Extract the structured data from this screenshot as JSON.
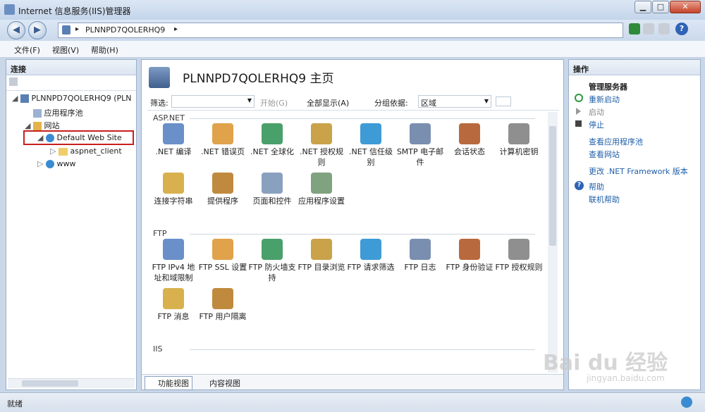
{
  "window": {
    "title": "Internet 信息服务(IIS)管理器",
    "min": "▁",
    "max": "□",
    "close": "✕"
  },
  "nav": {
    "back": "◀",
    "forward": "▶",
    "path": "PLNNPD7QOLERHQ9",
    "sep": "▸"
  },
  "menu": {
    "file": "文件(F)",
    "view": "视图(V)",
    "help": "帮助(H)"
  },
  "connections": {
    "title": "连接",
    "nodes": [
      {
        "label": "PLNNPD7QOLERHQ9 (PLN",
        "icon": "server-icon"
      },
      {
        "label": "应用程序池",
        "icon": "app-pool-icon"
      },
      {
        "label": "网站",
        "icon": "sites-folder-icon"
      },
      {
        "label": "Default Web Site",
        "icon": "globe-icon"
      },
      {
        "label": "aspnet_client",
        "icon": "folder-icon"
      },
      {
        "label": "www",
        "icon": "globe-icon"
      }
    ]
  },
  "main": {
    "title": "PLNNPD7QOLERHQ9 主页",
    "filter_label": "筛选:",
    "start": "开始(G)",
    "show_all": "全部显示(A)",
    "group_label": "分组依据:",
    "group_value": "区域",
    "groups": [
      {
        "name": "ASP.NET",
        "items": [
          ".NET 编译",
          ".NET 错误页",
          ".NET 全球化",
          ".NET 授权规则",
          ".NET 信任级别",
          "SMTP 电子邮件",
          "会话状态",
          "计算机密钥",
          "连接字符串",
          "提供程序",
          "页面和控件",
          "应用程序设置"
        ]
      },
      {
        "name": "FTP",
        "items": [
          "FTP IPv4 地址和域限制",
          "FTP SSL 设置",
          "FTP 防火墙支持",
          "FTP 目录浏览",
          "FTP 请求筛选",
          "FTP 日志",
          "FTP 身份验证",
          "FTP 授权规则",
          "FTP 消息",
          "FTP 用户隔离"
        ]
      },
      {
        "name": "IIS",
        "items": []
      }
    ],
    "tab_features": "功能视图",
    "tab_content": "内容视图"
  },
  "actions": {
    "title": "操作",
    "manage": "管理服务器",
    "restart": "重新启动",
    "start": "启动",
    "stop": "停止",
    "view_pools": "查看应用程序池",
    "view_sites": "查看网站",
    "change_net": "更改 .NET Framework 版本",
    "help": "帮助",
    "online_help": "联机帮助"
  },
  "status": {
    "text": "就绪"
  },
  "watermark": {
    "text": "Bai du 经验",
    "sub": "jingyan.baidu.com"
  }
}
